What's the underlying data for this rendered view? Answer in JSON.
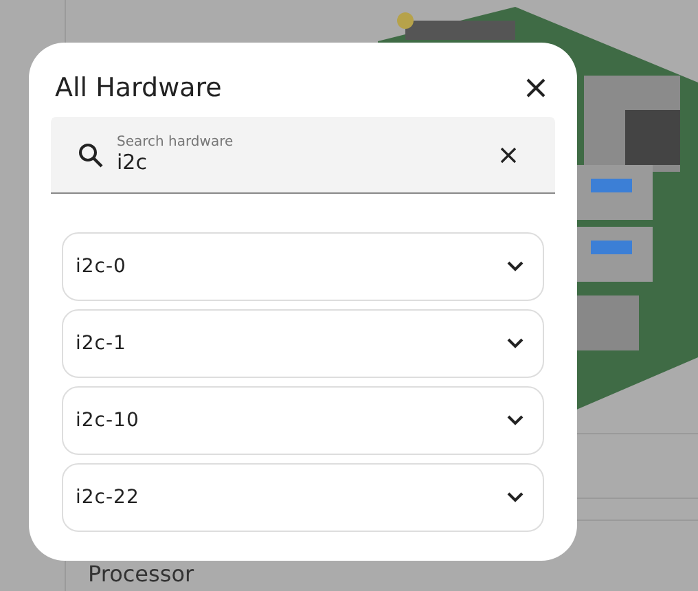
{
  "background": {
    "label": "Processor"
  },
  "dialog": {
    "title": "All Hardware",
    "search": {
      "placeholder": "Search hardware",
      "value": "i2c"
    },
    "items": [
      {
        "label": "i2c-0",
        "expanded": false
      },
      {
        "label": "i2c-1",
        "expanded": false
      },
      {
        "label": "i2c-10",
        "expanded": false
      },
      {
        "label": "i2c-22",
        "expanded": false
      }
    ]
  }
}
